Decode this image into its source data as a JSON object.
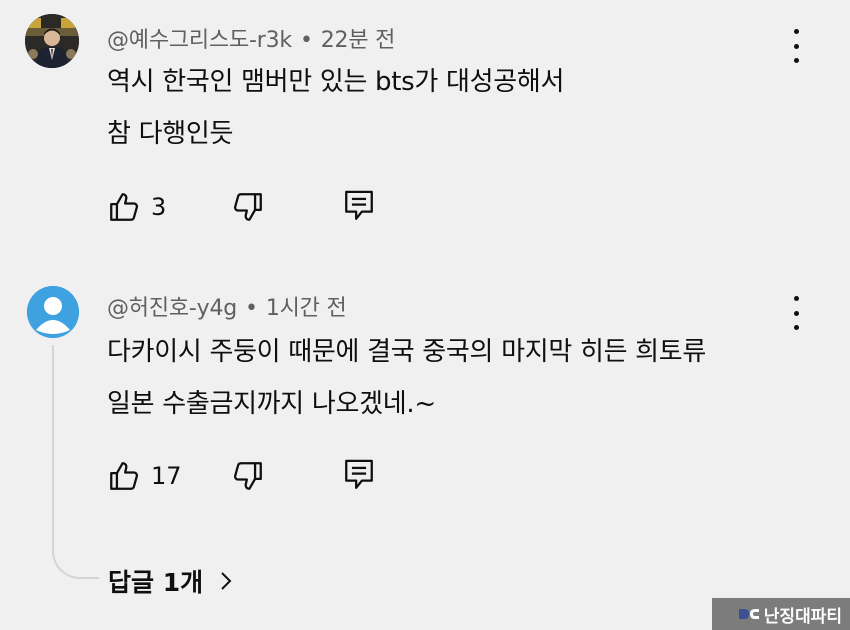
{
  "comments": [
    {
      "author": "@예수그리스도-r3k",
      "time": "22분 전",
      "lines": [
        "역시 한국인 맴버만 있는 bts가 대성공해서",
        "참 다행인듯"
      ],
      "likes": "3",
      "avatar": "profile-photo"
    },
    {
      "author": "@허진호-y4g",
      "time": "1시간 전",
      "lines": [
        "다카이시 주둥이 때문에 결국 중국의 마지막 히든 희토류",
        "일본 수출금지까지 나오겠네.~"
      ],
      "likes": "17",
      "avatar": "default-person"
    }
  ],
  "separator": "•",
  "replies_label": "답글 1개",
  "watermark": "난징대파티",
  "colors": {
    "background": "#f0f0f0",
    "text": "#0f0f0f",
    "meta": "#606060",
    "default_avatar": "#3ea1e0"
  },
  "icons": [
    "thumbs-up-icon",
    "thumbs-down-icon",
    "reply-comment-icon",
    "more-vert-icon",
    "chevron-right-icon"
  ]
}
